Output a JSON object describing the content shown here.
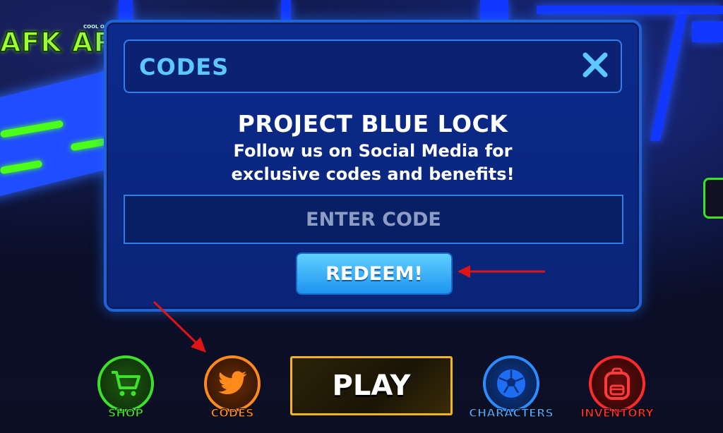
{
  "background": {
    "afk_sign": "AFK AR",
    "afk_sub": "COOL OR FREE"
  },
  "modal": {
    "title": "CODES",
    "close_icon": "close-icon",
    "heading": "PROJECT BLUE LOCK",
    "subheading": "Follow us on Social Media for exclusive codes and benefits!",
    "input_placeholder": "ENTER CODE",
    "input_value": "",
    "redeem_label": "REDEEM!"
  },
  "bottom_nav": {
    "shop": {
      "label": "SHOP",
      "icon": "shopping-cart-icon",
      "color": "#3ee12a"
    },
    "codes": {
      "label": "CODES",
      "icon": "twitter-bird-icon",
      "color": "#ff8a1c"
    },
    "play": {
      "label": "PLAY",
      "color": "#f2b51c"
    },
    "characters": {
      "label": "CHARACTERS",
      "icon": "soccer-ball-icon",
      "color": "#2b8cff"
    },
    "inventory": {
      "label": "INVENTORY",
      "icon": "backpack-icon",
      "color": "#ff2a2a"
    }
  },
  "colors": {
    "modal_bg": "#0a2478",
    "accent_blue": "#5cc8ff",
    "annotation_arrow": "#e01414"
  }
}
